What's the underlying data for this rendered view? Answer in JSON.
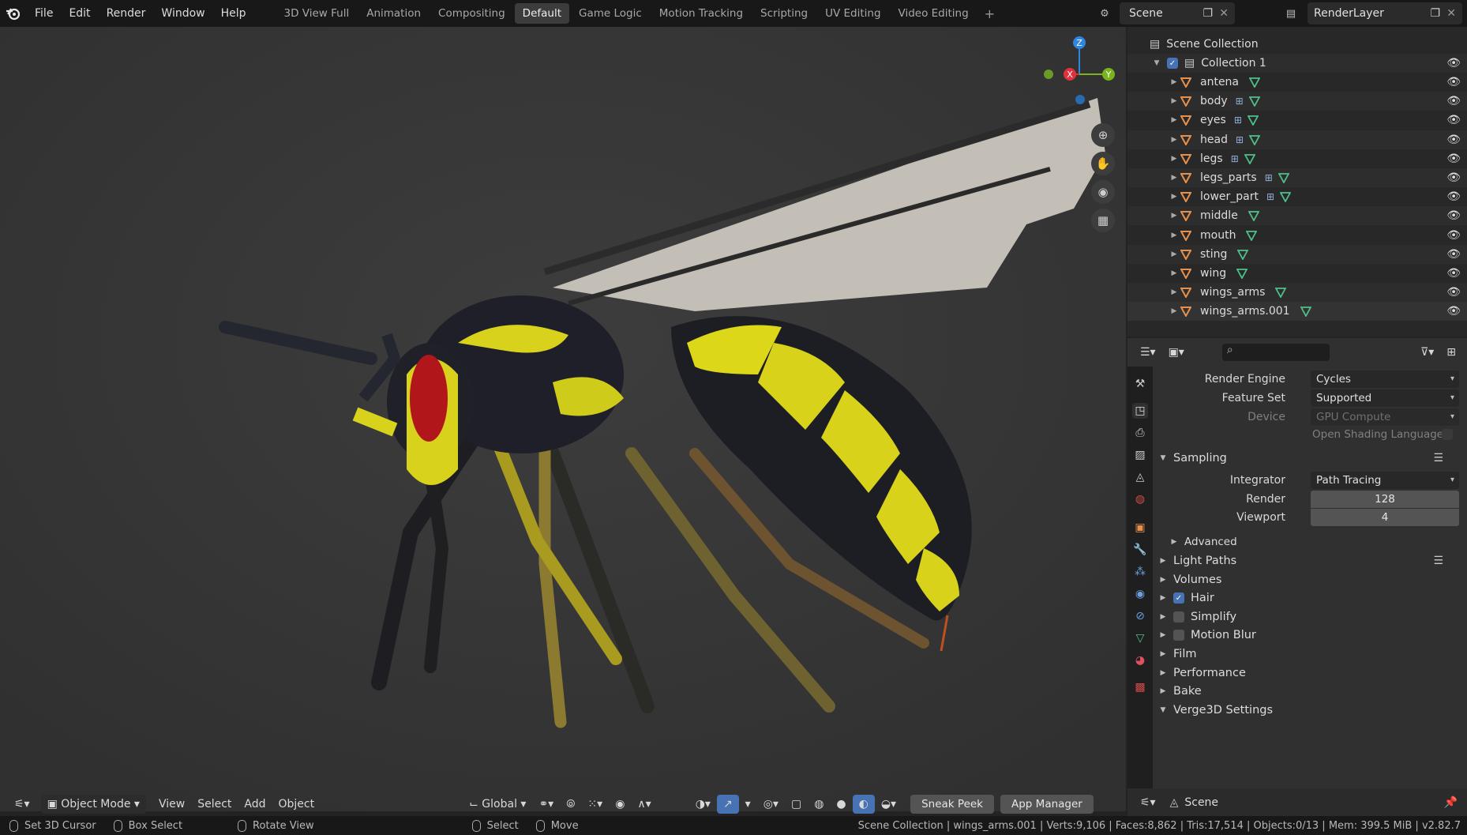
{
  "topbar": {
    "menu": [
      "File",
      "Edit",
      "Render",
      "Window",
      "Help"
    ],
    "workspaces": [
      "3D View Full",
      "Animation",
      "Compositing",
      "Default",
      "Game Logic",
      "Motion Tracking",
      "Scripting",
      "UV Editing",
      "Video Editing"
    ],
    "active_workspace": "Default",
    "scene_name": "Scene",
    "view_layer": "RenderLayer"
  },
  "viewport": {
    "mode": "Object Mode",
    "menus": [
      "View",
      "Select",
      "Add",
      "Object"
    ],
    "orientation": "Global",
    "sneak_peek": "Sneak Peek",
    "app_manager": "App Manager",
    "gizmo": {
      "z": "Z",
      "x": "X",
      "y": "Y"
    }
  },
  "statusbar": {
    "left": [
      "Set 3D Cursor",
      "Box Select",
      "Rotate View",
      "Select",
      "Move"
    ],
    "stats": "Scene Collection | wings_arms.001 | Verts:9,106 | Faces:8,862 | Tris:17,514 | Objects:0/13 | Mem: 399.5 MiB | v2.82.7"
  },
  "outliner": {
    "root": "Scene Collection",
    "collection": "Collection 1",
    "objects": [
      {
        "name": "antena",
        "modifiers": false
      },
      {
        "name": "body",
        "modifiers": true
      },
      {
        "name": "eyes",
        "modifiers": true
      },
      {
        "name": "head",
        "modifiers": true
      },
      {
        "name": "legs",
        "modifiers": true
      },
      {
        "name": "legs_parts",
        "modifiers": true
      },
      {
        "name": "lower_part",
        "modifiers": true
      },
      {
        "name": "middle",
        "modifiers": false
      },
      {
        "name": "mouth",
        "modifiers": false
      },
      {
        "name": "sting",
        "modifiers": false
      },
      {
        "name": "wing",
        "modifiers": false
      },
      {
        "name": "wings_arms",
        "modifiers": false
      },
      {
        "name": "wings_arms.001",
        "modifiers": false
      }
    ]
  },
  "properties": {
    "render_engine_label": "Render Engine",
    "render_engine": "Cycles",
    "feature_set_label": "Feature Set",
    "feature_set": "Supported",
    "device_label": "Device",
    "device": "GPU Compute",
    "osl_label": "Open Shading Language",
    "sampling": "Sampling",
    "integrator_label": "Integrator",
    "integrator": "Path Tracing",
    "render_label": "Render",
    "render_samples": "128",
    "viewport_label": "Viewport",
    "viewport_samples": "4",
    "advanced": "Advanced",
    "panels": [
      {
        "label": "Light Paths",
        "checkbox": null
      },
      {
        "label": "Volumes",
        "checkbox": null
      },
      {
        "label": "Hair",
        "checkbox": true
      },
      {
        "label": "Simplify",
        "checkbox": false
      },
      {
        "label": "Motion Blur",
        "checkbox": false
      },
      {
        "label": "Film",
        "checkbox": null
      },
      {
        "label": "Performance",
        "checkbox": null
      },
      {
        "label": "Bake",
        "checkbox": null
      },
      {
        "label": "Verge3D Settings",
        "checkbox": null
      }
    ],
    "footer_scene": "Scene"
  }
}
